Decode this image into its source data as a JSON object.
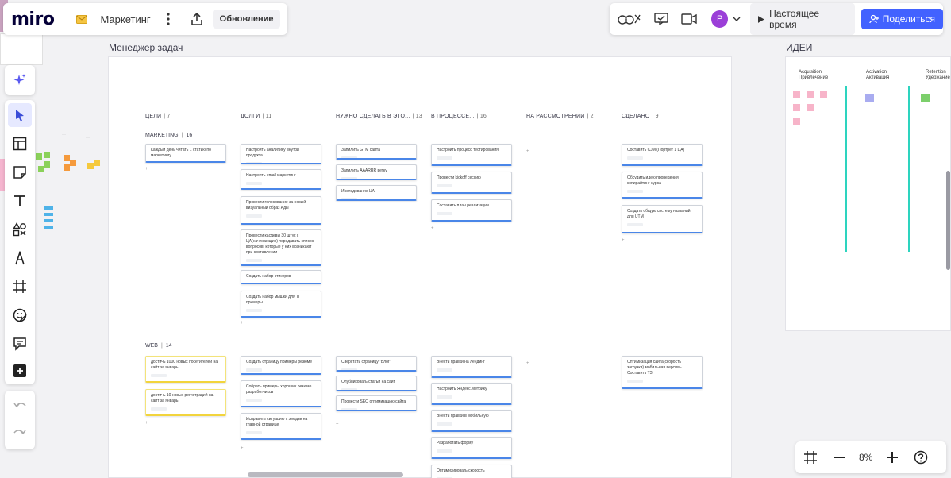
{
  "app": {
    "logo": "miro",
    "board_name": "Маркетинг",
    "update_label": "Обновление",
    "realtime_label": "Настоящее время",
    "share_label": "Поделиться",
    "avatar_letter": "P",
    "zoom": "8%"
  },
  "frames": {
    "task_manager_title": "Менеджер задач",
    "ideas_title": "ИДЕИ"
  },
  "columns": [
    {
      "label": "ЦЕЛИ",
      "count": "7",
      "color": "#a8a8b3"
    },
    {
      "label": "ДОЛГИ",
      "count": "11",
      "color": "#e0776b"
    },
    {
      "label": "НУЖНО СДЕЛАТЬ В ЭТО...",
      "count": "13",
      "color": "#a8a8b3"
    },
    {
      "label": "В ПРОЦЕССЕ...",
      "count": "16",
      "color": "#f2c94c"
    },
    {
      "label": "НА РАССМОТРЕНИИ",
      "count": "2",
      "color": "#a8a8b3"
    },
    {
      "label": "СДЕЛАНО",
      "count": "9",
      "color": "#8bc34a"
    }
  ],
  "swimlanes": {
    "marketing": {
      "label": "MARKETING",
      "count": "16"
    },
    "web": {
      "label": "WEB",
      "count": "14"
    }
  },
  "marketing_cards": {
    "goals": [
      "Каждый день читать 1 статью по маркетингу"
    ],
    "debts": [
      "Настроить аналитику внутри продукта",
      "Настроить email маркетинг",
      "Провести голосование за новый визуальный образ Ады",
      "Провести касдевы 30 штук с ЦА(начинающих) передавать список вопросов, которые у них возникают при составлении",
      "Создать набор стикеров",
      "Создать набор мышки для ТГ примеры"
    ],
    "todo": [
      "Запилить GTM сайта",
      "Запилить AAARRR ветку",
      "Исследование ЦА"
    ],
    "in_progress": [
      "Настроить процесс тестирования",
      "Провести kickoff сессию",
      "Составить план реализации"
    ],
    "done": [
      "Составить CJM (Портрет 1 ЦА)",
      "Обсудить идею проведения копирайтинг-курса",
      "Создать общую систему названий для UTM"
    ]
  },
  "web_cards": {
    "goals": [
      "достичь 1000 новых посетителей на сайт за январь",
      "достичь 10 новых регистраций на сайт за январь"
    ],
    "debts": [
      "Создать страницу примеры резюме",
      "Собрать примеры хороших резюме разработчиков",
      "Исправить ситуацию с эмодзи на главной странице"
    ],
    "todo": [
      "Сверстать страницу \"Блог\"",
      "Опубликовать статьи на сайт",
      "Провести SEO оптимизацию сайта"
    ],
    "in_progress": [
      "Внести правки на лендинг",
      "Настроить Яндекс.Метрику",
      "Внести правки в мобильную",
      "Разработать форму",
      "Оптимизировать скорость"
    ],
    "done": [
      "Оптимизация сайта(скорость загрузки) мобильная версия - Составить ТЗ"
    ]
  },
  "ideas": {
    "col1": "Acquisition\nПривлечение",
    "col2": "Activation\nАктивация",
    "col3": "Retention\nУдержание"
  },
  "colors": {
    "accent": "#4262ff",
    "card_border_blue": "#4a86e8",
    "card_border_yellow": "#f2d43c",
    "teal": "#2dd4bf"
  }
}
